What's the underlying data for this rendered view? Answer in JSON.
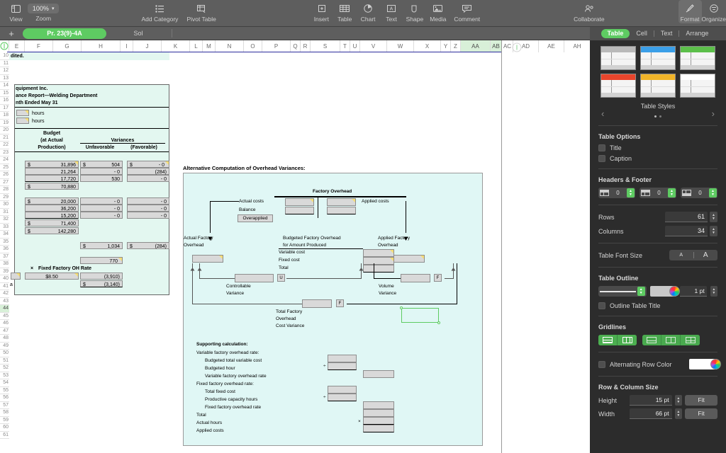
{
  "toolbar": {
    "items": [
      {
        "name": "view",
        "label": "View",
        "icon": "sidebar-icon"
      },
      {
        "name": "zoom",
        "label": "Zoom",
        "icon": "zoom-chevron-icon",
        "value": "100%"
      },
      {
        "name": "add-category",
        "label": "Add Category",
        "icon": "list-icon"
      },
      {
        "name": "pivot-table",
        "label": "Pivot Table",
        "icon": "pivot-icon"
      },
      {
        "name": "insert",
        "label": "Insert",
        "icon": "insert-icon"
      },
      {
        "name": "table",
        "label": "Table",
        "icon": "table-icon"
      },
      {
        "name": "chart",
        "label": "Chart",
        "icon": "chart-icon"
      },
      {
        "name": "text",
        "label": "Text",
        "icon": "text-icon"
      },
      {
        "name": "shape",
        "label": "Shape",
        "icon": "shape-icon"
      },
      {
        "name": "media",
        "label": "Media",
        "icon": "media-icon"
      },
      {
        "name": "comment",
        "label": "Comment",
        "icon": "comment-icon"
      },
      {
        "name": "collaborate",
        "label": "Collaborate",
        "icon": "collaborate-icon"
      },
      {
        "name": "format",
        "label": "Format",
        "icon": "paintbrush-icon"
      },
      {
        "name": "organize",
        "label": "Organize",
        "icon": "organize-icon"
      }
    ]
  },
  "tabbar": {
    "add_label": "+",
    "tabs": [
      {
        "label": "Pr. 23(9)-4A",
        "active": true
      },
      {
        "label": "Sol",
        "active": false
      }
    ]
  },
  "sheet": {
    "columns": [
      "E",
      "F",
      "G",
      "H",
      "I",
      "J",
      "K",
      "L",
      "M",
      "N",
      "O",
      "P",
      "Q",
      "R",
      "S",
      "T",
      "U",
      "V",
      "W",
      "X",
      "Y",
      "Z",
      "AA",
      "AB",
      "AC",
      "AD",
      "AE",
      "AH"
    ],
    "selected_column": "AA",
    "rows": [
      "10",
      "11",
      "12",
      "13",
      "14",
      "15",
      "16",
      "17",
      "18",
      "19",
      "20",
      "21",
      "22",
      "23",
      "24",
      "25",
      "26",
      "27",
      "28",
      "29",
      "30",
      "31",
      "32",
      "33",
      "34",
      "35",
      "36",
      "37",
      "38",
      "39",
      "40",
      "41",
      "42",
      "43",
      "44",
      "45",
      "46",
      "47",
      "48",
      "49",
      "50",
      "51",
      "52",
      "53",
      "54",
      "55",
      "56",
      "57",
      "58",
      "59",
      "60",
      "61"
    ],
    "selected_row": "44",
    "worksheet": {
      "note_row10": "dited.",
      "title_lines": [
        "quipment Inc.",
        "ance Report—Welding Department",
        "nth Ended May 31"
      ],
      "hours_rows": [
        "hours",
        "hours"
      ],
      "headers": {
        "budget_l1": "Budget",
        "budget_l2": "(at Actual",
        "budget_l3": "Production)",
        "variances": "Variances",
        "unfavorable": "Unfavorable",
        "favorable": "(Favorable)"
      },
      "budget_col": [
        {
          "dollar": "$",
          "value": "31,896"
        },
        {
          "dollar": "",
          "value": "21,264"
        },
        {
          "dollar": "",
          "value": "17,720"
        },
        {
          "dollar": "$",
          "value": "70,880"
        },
        {
          "dollar": "$",
          "value": "20,000"
        },
        {
          "dollar": "",
          "value": "36,200"
        },
        {
          "dollar": "",
          "value": "15,200"
        },
        {
          "dollar": "$",
          "value": "71,400"
        },
        {
          "dollar": "$",
          "value": "142,280"
        }
      ],
      "unfav_col": [
        {
          "dollar": "$",
          "value": "504"
        },
        {
          "dollar": "",
          "value": "- 0"
        },
        {
          "dollar": "",
          "value": "530"
        },
        {
          "dollar": "",
          "value": "- 0"
        },
        {
          "dollar": "",
          "value": "- 0"
        },
        {
          "dollar": "",
          "value": "- 0"
        }
      ],
      "fav_col": [
        {
          "dollar": "$",
          "value": "- 0"
        },
        {
          "dollar": "",
          "value": "(284)"
        },
        {
          "dollar": "",
          "value": "- 0"
        },
        {
          "dollar": "",
          "value": "- 0"
        },
        {
          "dollar": "",
          "value": "- 0"
        },
        {
          "dollar": "",
          "value": "- 0"
        }
      ],
      "totals": {
        "unfav_total_dollar": "$",
        "unfav_total": "1,034",
        "fav_total_dollar": "$",
        "fav_total": "(284)",
        "sub": "770"
      },
      "fixed_rate_label": "Fixed Factory OH Rate",
      "fixed_rate_op": "×",
      "fixed_rate_value": "$8.50",
      "lower_values": [
        "(3,910)"
      ],
      "grand_total_dollar": "$",
      "grand_total": "(3,140)"
    }
  },
  "diagram": {
    "title": "Alternative Computation of Overhead Variances:",
    "factory_overhead": "Factory Overhead",
    "actual_costs": "Actual costs",
    "balance": "Balance",
    "overapplied": "Overapplied",
    "applied_costs": "Applied costs",
    "actual_factory_overhead": [
      "Actual Factory",
      "Overhead"
    ],
    "budgeted_factory_overhead": [
      "Budgeted Factory Overhead",
      "for Amount Produced"
    ],
    "applied_factory_overhead": [
      "Applied Factory",
      "Overhead"
    ],
    "budget_lines": [
      "Variable cost",
      "Fixed cost",
      "Total"
    ],
    "controllable_variance": [
      "Controllable",
      "Variance"
    ],
    "volume_variance": [
      "Volume",
      "Variance"
    ],
    "total_variance": [
      "Total Factory",
      "Overhead",
      "Cost Variance"
    ],
    "flag_u": "U",
    "flag_f1": "F",
    "flag_f2": "F",
    "supporting": {
      "heading": "Supporting calculation:",
      "lines": [
        "Variable factory overhead rate:",
        "Budgeted total variable cost",
        "Budgeted hour",
        "Variable factory overhead rate",
        "Fixed factory overhead rate:",
        "Total fixed cost",
        "Productive capacity hours",
        "Fixed factory overhead rate",
        "Total",
        "Actual hours",
        "Applied costs"
      ],
      "op_divide1": "÷",
      "op_divide2": "÷",
      "op_multiply": "×"
    }
  },
  "sidebar": {
    "tabs": [
      {
        "label": "Table",
        "active": true
      },
      {
        "label": "Cell",
        "active": false
      },
      {
        "label": "Text",
        "active": false
      },
      {
        "label": "Arrange",
        "active": false
      }
    ],
    "styles_title": "Table Styles",
    "style_colors": [
      "#b9b9b9",
      "#3b9fe8",
      "#5cbf4a",
      "#e8452c",
      "#f0b429",
      "#ffffff"
    ],
    "table_options_heading": "Table Options",
    "title_checkbox": "Title",
    "caption_checkbox": "Caption",
    "headers_footer_heading": "Headers & Footer",
    "header_rows": "0",
    "header_cols": "0",
    "footer_rows": "0",
    "rows_label": "Rows",
    "rows_value": "61",
    "columns_label": "Columns",
    "columns_value": "34",
    "font_size_label": "Table Font Size",
    "font_small": "A",
    "font_large": "A",
    "outline_heading": "Table Outline",
    "outline_width": "1 pt",
    "outline_title_checkbox": "Outline Table Title",
    "gridlines_heading": "Gridlines",
    "alt_row_color": "Alternating Row Color",
    "row_col_heading": "Row & Column Size",
    "height_label": "Height",
    "height_value": "15 pt",
    "width_label": "Width",
    "width_value": "66 pt",
    "fit_label": "Fit",
    "accent": "#5ecb62"
  }
}
